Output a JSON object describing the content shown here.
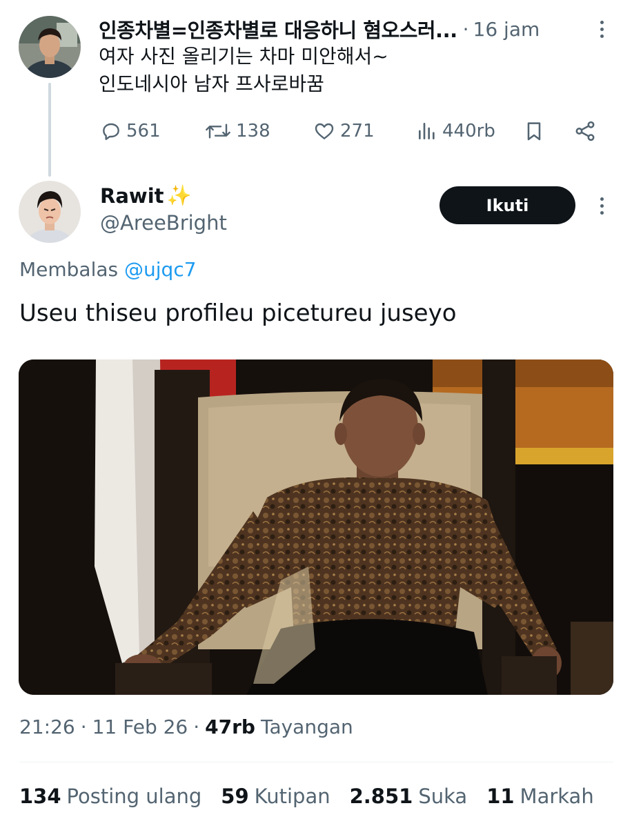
{
  "parent_tweet": {
    "author_name": "인종차별=인종차별로 대응하니 혐오스러...",
    "separator": "·",
    "time_ago": "16 jam",
    "body_lines": [
      "여자 사진 올리기는 차마 미안해서~",
      "인도네시아 남자 프사로바꿈"
    ],
    "actions": {
      "replies": "561",
      "reposts": "138",
      "likes": "271",
      "views": "440rb"
    }
  },
  "reply_tweet": {
    "display_name": "Rawit",
    "display_name_emoji": "✨",
    "handle": "@AreeBright",
    "follow_label": "Ikuti",
    "replying_label": "Membalas",
    "replying_to": "@ujqc7",
    "text": "Useu thiseu profileu picetureu juseyo",
    "timestamp_time": "21:26",
    "timestamp_date": "11 Feb 26",
    "separator": "·",
    "views_count": "47rb",
    "views_label": "Tayangan",
    "stats": [
      {
        "count": "134",
        "label": "Posting ulang"
      },
      {
        "count": "59",
        "label": "Kutipan"
      },
      {
        "count": "2.851",
        "label": "Suka"
      },
      {
        "count": "11",
        "label": "Markah"
      }
    ]
  },
  "colors": {
    "text_primary": "#0f1419",
    "text_secondary": "#536471",
    "accent_blue": "#1d9bf0",
    "button_dark": "#0f1419",
    "thread_line": "#cfd9de"
  },
  "icons": [
    "reply-icon",
    "repost-icon",
    "like-icon",
    "views-icon",
    "bookmark-icon",
    "share-icon",
    "more-icon"
  ]
}
